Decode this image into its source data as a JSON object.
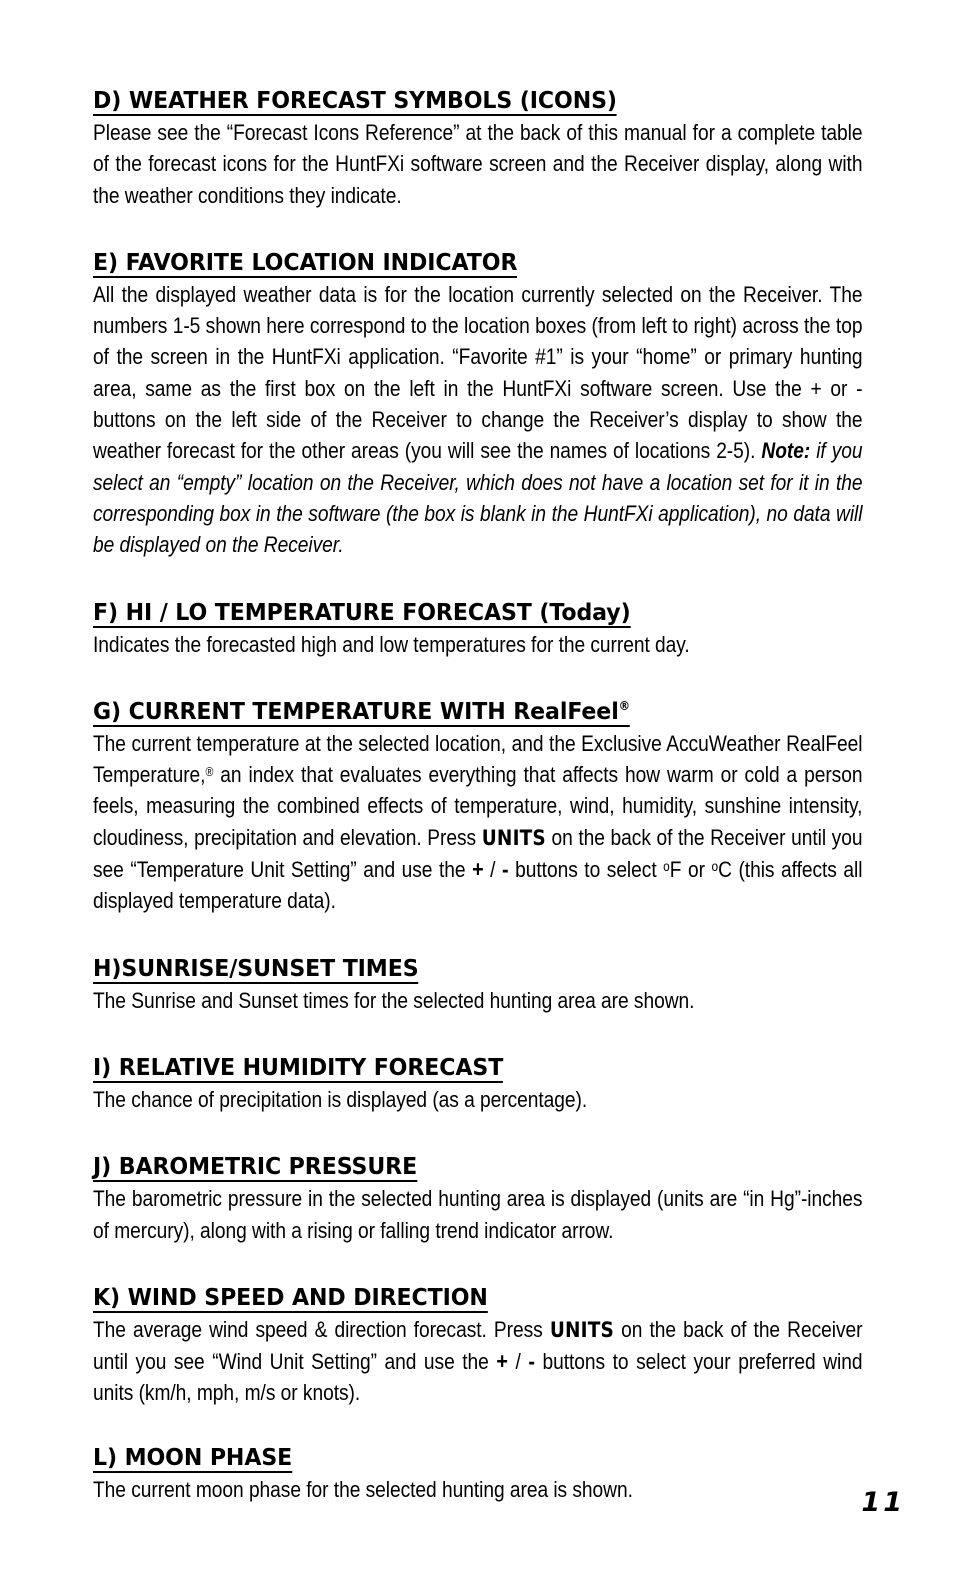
{
  "document": {
    "page_number": "11",
    "text_color": "#000000",
    "background_color": "#ffffff"
  },
  "sections": [
    {
      "id": "d",
      "heading": "D) WEATHER FORECAST SYMBOLS (ICONS)",
      "body": "Please see the “Forecast Icons Reference” at the back of this manual for a complete table of the forecast icons for the HuntFXi software screen and the Receiver display, along with the weather conditions they indicate."
    },
    {
      "id": "e",
      "heading": "E) FAVORITE LOCATION INDICATOR",
      "body_part1": "All the displayed weather data is for the location currently selected on the Receiver. The numbers 1-5 shown here correspond to the location boxes (from left to right) across the top of the screen in the HuntFXi application. “Favorite #1” is your “home” or primary hunting area, same as the first box on the left in the HuntFXi software screen. Use the + or - buttons on the left side of the Receiver to change the Receiver’s display to show the weather forecast for the other areas (you will see the names of locations 2-5). ",
      "note_label": "Note:",
      "note_body": " if you select an “empty” location on the Receiver, which does not have a location set for it in the corresponding box in the software (the box is blank in the HuntFXi application), no data will be displayed on the Receiver."
    },
    {
      "id": "f",
      "heading": "F) HI / LO TEMPERATURE FORECAST (Today)",
      "body": "Indicates the forecasted high and low temperatures for the current day."
    },
    {
      "id": "g",
      "heading_main": "G) CURRENT TEMPERATURE WITH RealFeel",
      "heading_sup": "®",
      "body_part1": "The current temperature at the selected location, and the Exclusive AccuWeather RealFeel Temperature,",
      "body_sup1": "®",
      "body_part2": " an index that evaluates everything that affects how warm or cold a person feels, measuring the combined effects of temperature, wind, humidity, sunshine intensity, cloudiness, precipitation and elevation. Press ",
      "units_label": "UNITS",
      "body_part3": " on the back of the Receiver until you see “Temperature Unit Setting” and use the ",
      "plus": "+",
      "slash": "/",
      "minus": "-",
      "body_part4": " buttons to select ",
      "deg_f_symbol": "o",
      "deg_f_letter": "F",
      "body_part5": " or ",
      "deg_c_symbol": "o",
      "deg_c_letter": "C",
      "body_part6": " (this affects all displayed temperature data)."
    },
    {
      "id": "h",
      "heading": "H)SUNRISE/SUNSET TIMES",
      "body": "The Sunrise and Sunset times for the selected hunting area are shown."
    },
    {
      "id": "i",
      "heading": "I) RELATIVE HUMIDITY FORECAST",
      "body": "The chance of precipitation is displayed (as a percentage)."
    },
    {
      "id": "j",
      "heading": "J) BAROMETRIC PRESSURE",
      "body": "The barometric pressure in the selected hunting area is displayed (units are “in Hg”-inches of mercury), along with a rising or falling trend indicator arrow."
    },
    {
      "id": "k",
      "heading": "K) WIND SPEED AND DIRECTION",
      "body_part1": "The average wind speed & direction forecast. Press ",
      "units_label": "UNITS",
      "body_part2": " on the back of the Receiver until you see “Wind Unit Setting” and use the ",
      "plus": "+",
      "slash": "/",
      "minus": "-",
      "body_part3": " buttons to select your preferred wind units (km/h, mph, m/s or knots)."
    },
    {
      "id": "l",
      "heading": "L) MOON PHASE",
      "body": "The current moon phase for the selected hunting area is shown."
    }
  ]
}
